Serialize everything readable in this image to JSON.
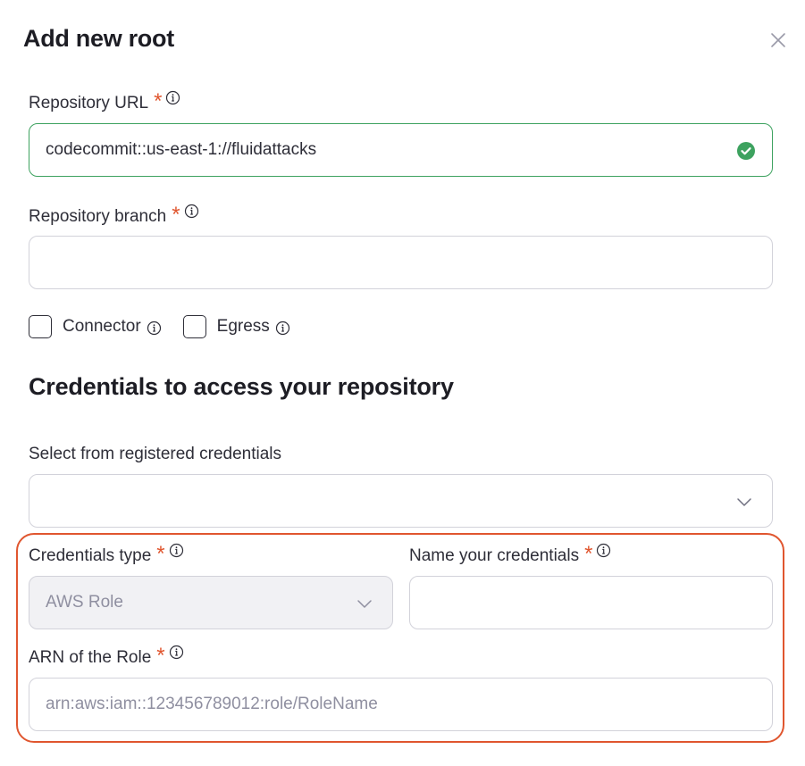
{
  "dialog": {
    "title": "Add new root",
    "close_icon": "close-icon"
  },
  "repo_url": {
    "label": "Repository URL",
    "required": "*",
    "value": "codecommit::us-east-1://fluidattacks",
    "status_icon": "check-circle-icon",
    "status_color": "#3da25f"
  },
  "repo_branch": {
    "label": "Repository branch",
    "required": "*",
    "value": ""
  },
  "options": {
    "connector_label": "Connector",
    "egress_label": "Egress"
  },
  "credentials": {
    "heading": "Credentials to access your repository",
    "registered_label": "Select from registered credentials",
    "registered_value": "",
    "type_label": "Credentials type",
    "type_required": "*",
    "type_value": "AWS Role",
    "name_label": "Name your credentials",
    "name_required": "*",
    "name_value": "",
    "arn_label": "ARN of the Role",
    "arn_required": "*",
    "arn_placeholder": "arn:aws:iam::123456789012:role/RoleName"
  },
  "colors": {
    "accent": "#e0562f",
    "valid": "#3da25f"
  }
}
